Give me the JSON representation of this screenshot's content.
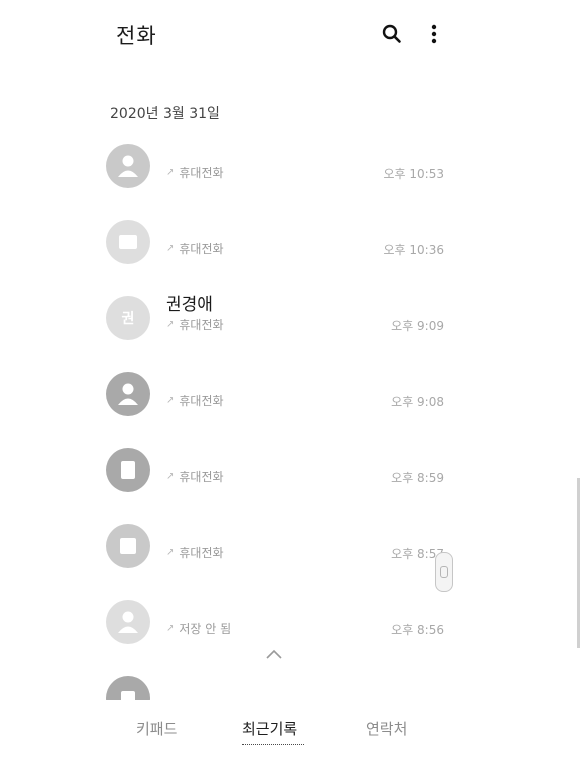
{
  "header": {
    "title": "전화",
    "icons": {
      "search": "search-icon",
      "more": "more-options-icon"
    }
  },
  "date_header": "2020년 3월 31일",
  "calls": [
    {
      "name": "",
      "avatar": "person-silhouette-icon",
      "avatar_text": "",
      "type": "휴대전화",
      "time": "오후 10:53"
    },
    {
      "name": "",
      "avatar": "photo-avatar-icon",
      "avatar_text": "",
      "type": "휴대전화",
      "time": "오후 10:36"
    },
    {
      "name": "권경애",
      "avatar": "initial-avatar",
      "avatar_text": "권",
      "type": "휴대전화",
      "time": "오후 9:09"
    },
    {
      "name": "",
      "avatar": "person-silhouette-icon",
      "avatar_text": "",
      "type": "휴대전화",
      "time": "오후 9:08"
    },
    {
      "name": "",
      "avatar": "photo-avatar-icon",
      "avatar_text": "",
      "type": "휴대전화",
      "time": "오후 8:59"
    },
    {
      "name": "",
      "avatar": "photo-avatar-icon",
      "avatar_text": "",
      "type": "휴대전화",
      "time": "오후 8:57"
    },
    {
      "name": "",
      "avatar": "person-silhouette-icon",
      "avatar_text": "",
      "type": "저장 안 됨",
      "time": "오후 8:56"
    }
  ],
  "tabs": [
    {
      "label": "키패드",
      "active": false
    },
    {
      "label": "최근기록",
      "active": true
    },
    {
      "label": "연락처",
      "active": false
    }
  ]
}
